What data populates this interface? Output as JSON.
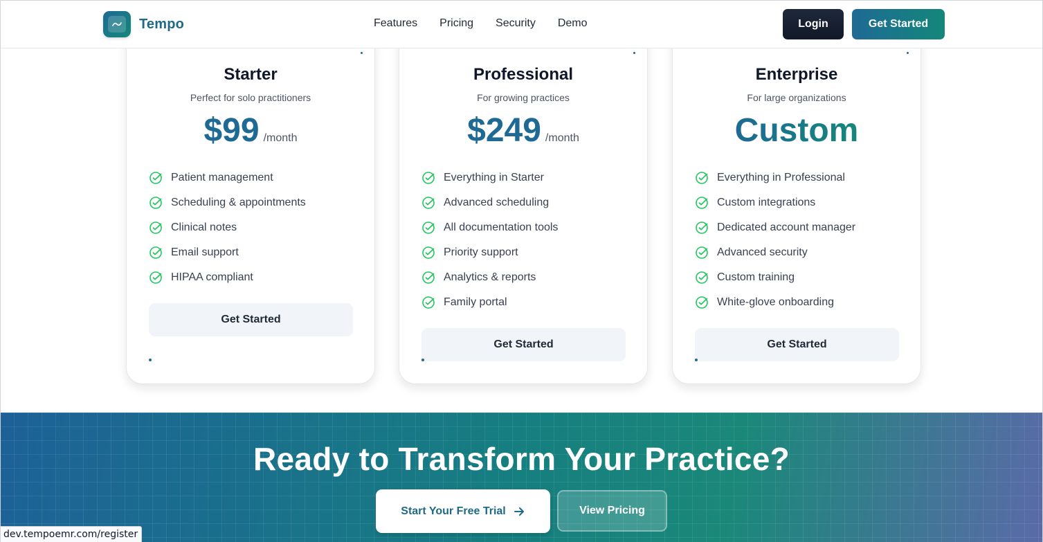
{
  "nav": {
    "brand": "Tempo",
    "links": [
      "Features",
      "Pricing",
      "Security",
      "Demo"
    ],
    "login_label": "Login",
    "get_started_label": "Get Started"
  },
  "plans": [
    {
      "name": "Starter",
      "subtitle": "Perfect for solo practitioners",
      "price": "$99",
      "period": "/month",
      "features": [
        "Patient management",
        "Scheduling & appointments",
        "Clinical notes",
        "Email support",
        "HIPAA compliant"
      ],
      "button": "Get Started"
    },
    {
      "name": "Professional",
      "subtitle": "For growing practices",
      "price": "$249",
      "period": "/month",
      "features": [
        "Everything in Starter",
        "Advanced scheduling",
        "All documentation tools",
        "Priority support",
        "Analytics & reports",
        "Family portal"
      ],
      "button": "Get Started"
    },
    {
      "name": "Enterprise",
      "subtitle": "For large organizations",
      "price": "Custom",
      "period": "",
      "features": [
        "Everything in Professional",
        "Custom integrations",
        "Dedicated account manager",
        "Advanced security",
        "Custom training",
        "White-glove onboarding"
      ],
      "button": "Get Started"
    }
  ],
  "cta": {
    "title": "Ready to Transform Your Practice?",
    "trial_label": "Start Your Free Trial",
    "view_pricing_label": "View Pricing"
  },
  "status_bar": {
    "url": "dev.tempoemr.com/register"
  },
  "colors": {
    "brand": "#1e6a94",
    "accent": "#14877a",
    "check": "#22c55e"
  },
  "icons": {
    "logo": "trend-line-icon",
    "check": "check-circle-icon",
    "arrow": "arrow-right-icon"
  }
}
